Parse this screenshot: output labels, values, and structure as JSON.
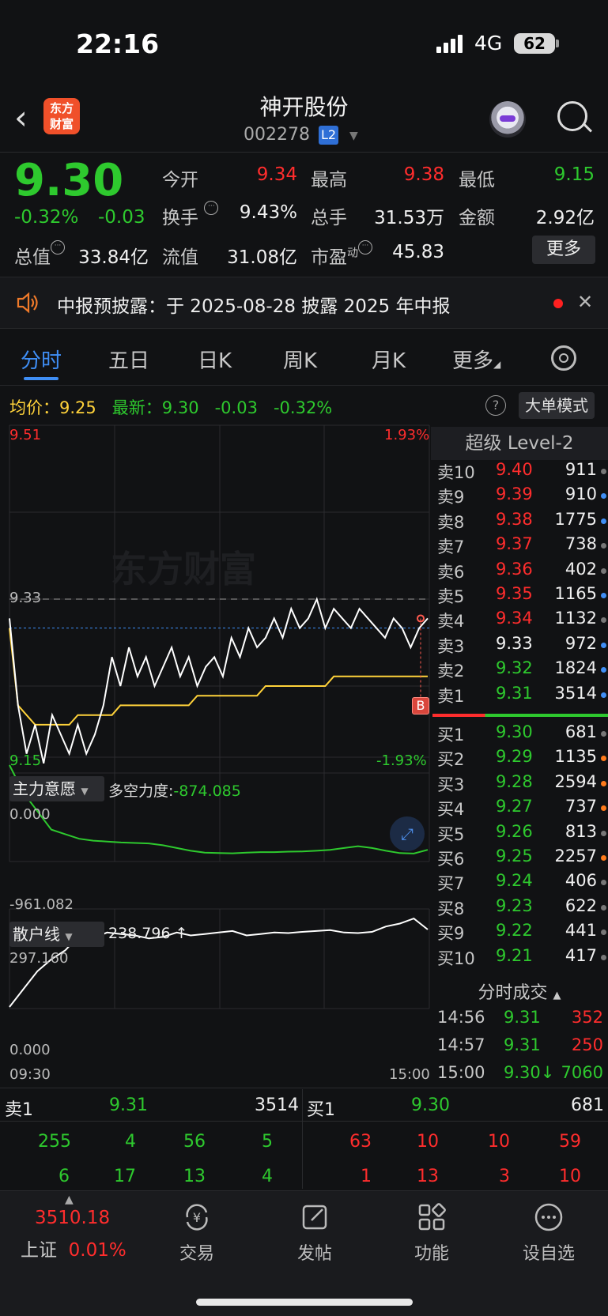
{
  "status": {
    "time": "22:16",
    "network": "4G",
    "battery": "62"
  },
  "header": {
    "logo_line1": "东方",
    "logo_line2": "财富",
    "stock_name": "神开股份",
    "stock_code": "002278",
    "level_badge": "L2"
  },
  "quote": {
    "price": "9.30",
    "change_pct": "-0.32%",
    "change": "-0.03",
    "open_label": "今开",
    "open": "9.34",
    "high_label": "最高",
    "high": "9.38",
    "low_label": "最低",
    "low": "9.15",
    "turnover_label": "换手",
    "turnover": "9.43%",
    "volume_label": "总手",
    "volume": "31.53万",
    "amount_label": "金额",
    "amount": "2.92亿",
    "mktcap_label": "总值",
    "mktcap": "33.84亿",
    "float_label": "流值",
    "float": "31.08亿",
    "pe_label": "市盈",
    "pe_sup": "动",
    "pe": "45.83",
    "more_btn": "更多"
  },
  "notice": {
    "text": "中报预披露：于 2025-08-28 披露 2025 年中报"
  },
  "tabs": [
    "分时",
    "五日",
    "日K",
    "周K",
    "月K",
    "更多"
  ],
  "info": {
    "avg_label": "均价：",
    "avg": "9.25",
    "latest_label": "最新：",
    "latest": "9.30",
    "latest_chg": "-0.03",
    "latest_pct": "-0.32%",
    "help": "?",
    "big_mode": "大单模式"
  },
  "chart": {
    "y_top": "9.51",
    "y_top_pct": "1.93%",
    "y_prev": "9.33",
    "y_bot": "9.15",
    "y_bot_pct": "-1.93%",
    "marker": "B",
    "indicator1_name": "主力意愿",
    "indicator1_extra_label": "多空力度:",
    "indicator1_extra": "-874.085",
    "ind1_top": "0.000",
    "ind1_bot": "-961.082",
    "indicator2_name": "散户线",
    "indicator2_val": "238.796 ↑",
    "ind2_top": "297.160",
    "ind2_bot": "0.000",
    "x_start": "09:30",
    "x_end": "15:00",
    "watermark": "东方财富"
  },
  "chart_data": {
    "type": "line",
    "x_range": [
      "09:30",
      "15:00"
    ],
    "ylim": [
      9.15,
      9.51
    ],
    "prev_close": 9.33,
    "series": [
      {
        "name": "最新",
        "values": [
          9.31,
          9.22,
          9.17,
          9.2,
          9.16,
          9.21,
          9.19,
          9.17,
          9.2,
          9.17,
          9.19,
          9.22,
          9.27,
          9.24,
          9.28,
          9.25,
          9.27,
          9.24,
          9.26,
          9.28,
          9.25,
          9.27,
          9.24,
          9.26,
          9.27,
          9.25,
          9.29,
          9.27,
          9.3,
          9.28,
          9.29,
          9.31,
          9.29,
          9.32,
          9.3,
          9.31,
          9.33,
          9.3,
          9.32,
          9.31,
          9.3,
          9.32,
          9.31,
          9.3,
          9.29,
          9.31,
          9.3,
          9.28,
          9.3,
          9.31
        ]
      },
      {
        "name": "均价",
        "values": [
          9.3,
          9.22,
          9.21,
          9.2,
          9.2,
          9.2,
          9.2,
          9.2,
          9.21,
          9.21,
          9.21,
          9.21,
          9.21,
          9.22,
          9.22,
          9.22,
          9.22,
          9.22,
          9.22,
          9.22,
          9.22,
          9.22,
          9.23,
          9.23,
          9.23,
          9.23,
          9.23,
          9.23,
          9.23,
          9.23,
          9.24,
          9.24,
          9.24,
          9.24,
          9.24,
          9.24,
          9.24,
          9.24,
          9.25,
          9.25,
          9.25,
          9.25,
          9.25,
          9.25,
          9.25,
          9.25,
          9.25,
          9.25,
          9.25,
          9.25
        ]
      }
    ],
    "indicator1": [
      0,
      -300,
      -500,
      -700,
      -750,
      -800,
      -820,
      -830,
      -840,
      -845,
      -850,
      -870,
      -900,
      -930,
      -950,
      -955,
      -958,
      -950,
      -945,
      -945,
      -940,
      -938,
      -930,
      -920,
      -900,
      -880,
      -900,
      -930,
      -955,
      -960,
      -920
    ],
    "indicator2": [
      0,
      60,
      120,
      160,
      190,
      240,
      230,
      250,
      245,
      240,
      230,
      235,
      250,
      240,
      245,
      250,
      255,
      240,
      245,
      250,
      248,
      252,
      255,
      258,
      250,
      248,
      252,
      270,
      280,
      297,
      260
    ]
  },
  "orderbook": {
    "title": "超级 Level-2",
    "asks": [
      {
        "label": "卖10",
        "price": "9.40",
        "vol": "911",
        "dot": "#777777"
      },
      {
        "label": "卖9",
        "price": "9.39",
        "vol": "910",
        "dot": "#3f8ef5"
      },
      {
        "label": "卖8",
        "price": "9.38",
        "vol": "1775",
        "dot": "#3f8ef5"
      },
      {
        "label": "卖7",
        "price": "9.37",
        "vol": "738",
        "dot": "#777777"
      },
      {
        "label": "卖6",
        "price": "9.36",
        "vol": "402",
        "dot": "#777777"
      },
      {
        "label": "卖5",
        "price": "9.35",
        "vol": "1165",
        "dot": "#3f8ef5"
      },
      {
        "label": "卖4",
        "price": "9.34",
        "vol": "1132",
        "dot": "#777777"
      },
      {
        "label": "卖3",
        "price": "9.33",
        "vol": "972",
        "dot": "#3f8ef5"
      },
      {
        "label": "卖2",
        "price": "9.32",
        "vol": "1824",
        "dot": "#3f8ef5"
      },
      {
        "label": "卖1",
        "price": "9.31",
        "vol": "3514",
        "dot": "#3f8ef5"
      }
    ],
    "bids": [
      {
        "label": "买1",
        "price": "9.30",
        "vol": "681",
        "dot": "#777777"
      },
      {
        "label": "买2",
        "price": "9.29",
        "vol": "1135",
        "dot": "#ff7a1a"
      },
      {
        "label": "买3",
        "price": "9.28",
        "vol": "2594",
        "dot": "#ff7a1a"
      },
      {
        "label": "买4",
        "price": "9.27",
        "vol": "737",
        "dot": "#ff7a1a"
      },
      {
        "label": "买5",
        "price": "9.26",
        "vol": "813",
        "dot": "#777777"
      },
      {
        "label": "买6",
        "price": "9.25",
        "vol": "2257",
        "dot": "#ff7a1a"
      },
      {
        "label": "买7",
        "price": "9.24",
        "vol": "406",
        "dot": "#777777"
      },
      {
        "label": "买8",
        "price": "9.23",
        "vol": "622",
        "dot": "#777777"
      },
      {
        "label": "买9",
        "price": "9.22",
        "vol": "441",
        "dot": "#777777"
      },
      {
        "label": "买10",
        "price": "9.21",
        "vol": "417",
        "dot": "#777777"
      }
    ],
    "trade_title": "分时成交",
    "trades": [
      {
        "time": "14:56",
        "price": "9.31",
        "vol": "352"
      },
      {
        "time": "14:57",
        "price": "9.31",
        "vol": "250"
      },
      {
        "time": "15:00",
        "price": "9.30↓",
        "vol": "7060"
      }
    ]
  },
  "bottom_quote": {
    "sell_label": "卖1",
    "sell_price": "9.31",
    "sell_vol": "3514",
    "buy_label": "买1",
    "buy_price": "9.30",
    "buy_vol": "681",
    "sell_row1": [
      "255",
      "4",
      "56",
      "5"
    ],
    "sell_row2": [
      "6",
      "17",
      "13",
      "4"
    ],
    "buy_row1": [
      "63",
      "10",
      "10",
      "59"
    ],
    "buy_row2": [
      "1",
      "13",
      "3",
      "10"
    ]
  },
  "nav": {
    "index_value": "3510.18",
    "index_name": "上证",
    "index_pct": "0.01%",
    "items": [
      "交易",
      "发帖",
      "功能",
      "设自选"
    ]
  },
  "colors": {
    "up": "#ff2d2d",
    "down": "#2ec92e",
    "accent": "#3f8ef5",
    "avg_line": "#ffd23a"
  }
}
